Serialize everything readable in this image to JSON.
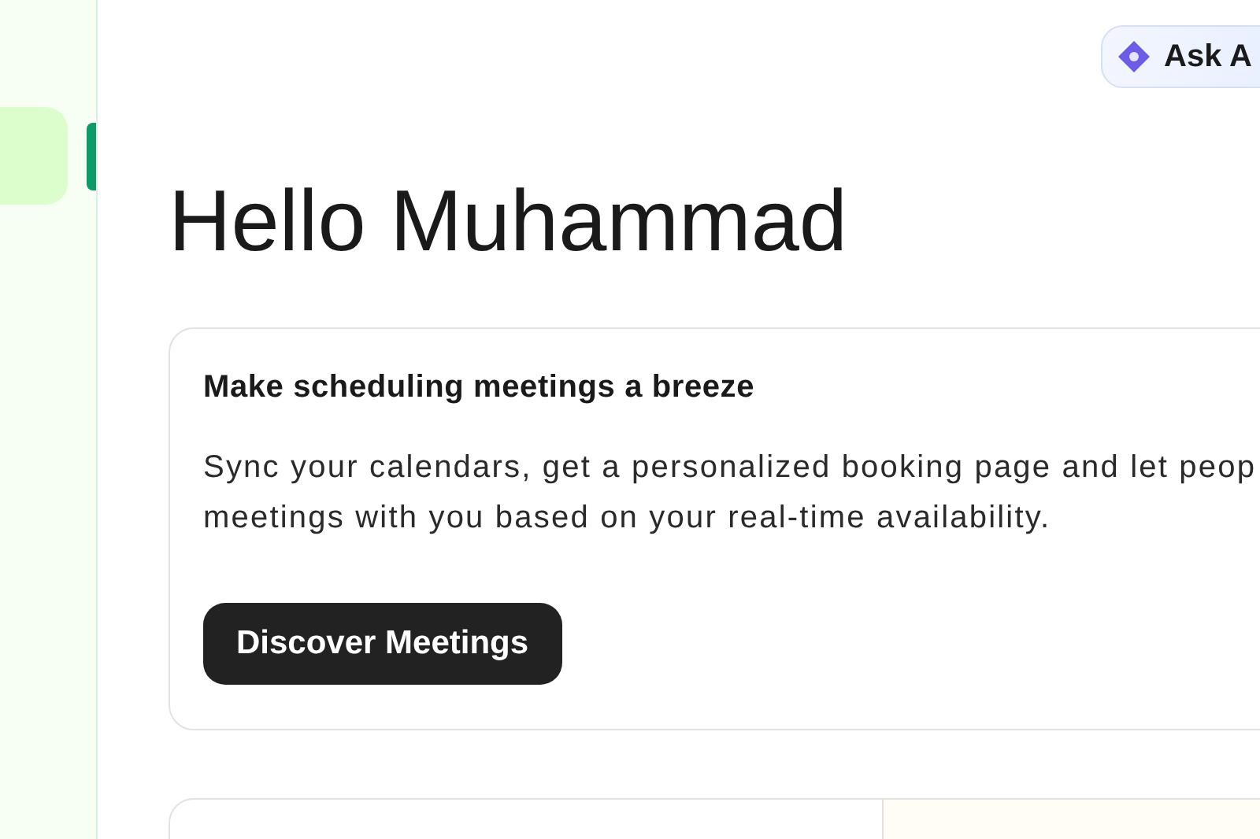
{
  "sidebar": {
    "items": [
      {
        "selected": true
      }
    ]
  },
  "header": {
    "ask_button": "Ask A"
  },
  "greeting": "Hello Muhammad",
  "promo_card": {
    "title": "Make scheduling meetings a breeze",
    "text": "Sync your calendars, get a personalized booking page and let peop\nmeetings with you based on your real-time availability.",
    "button": "Discover Meetings"
  }
}
